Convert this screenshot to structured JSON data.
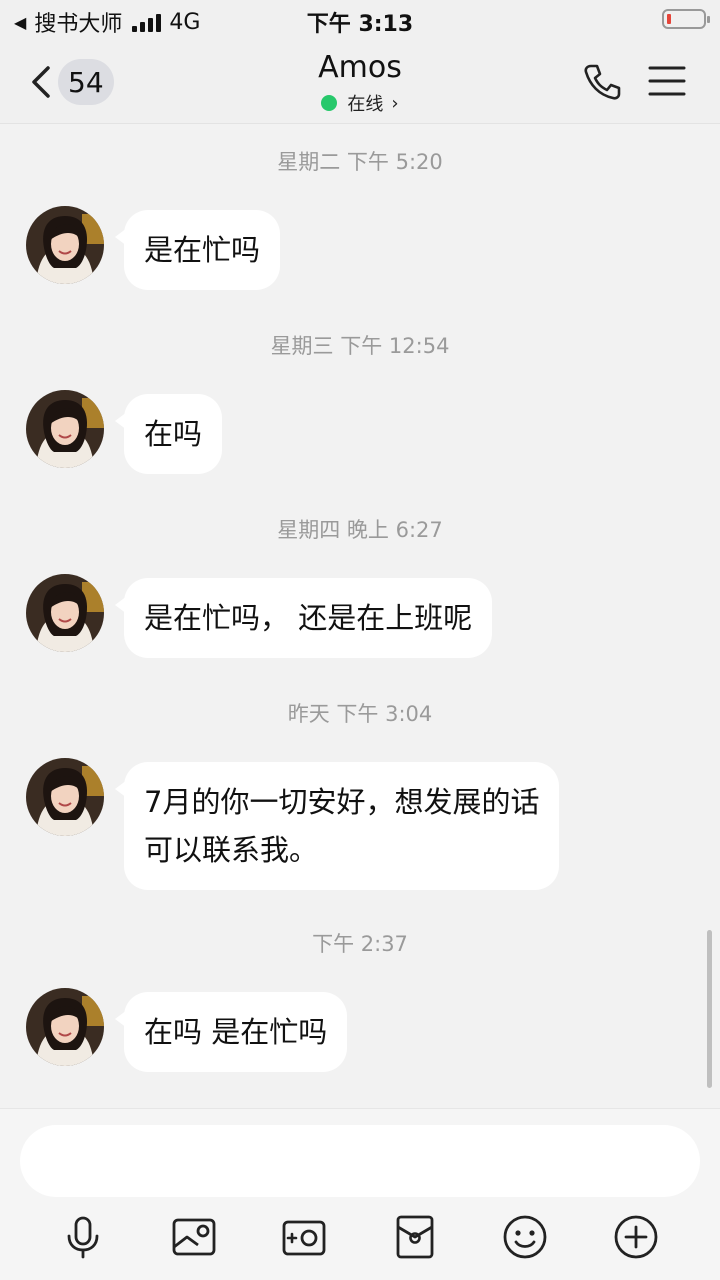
{
  "status_bar": {
    "carrier": "搜书大师",
    "network": "4G",
    "time": "下午 3:13"
  },
  "header": {
    "unread_count": "54",
    "contact_name": "Amos",
    "online_status": "在线",
    "online_color": "#27c86b"
  },
  "messages": [
    {
      "time": "星期二 下午 5:20",
      "text": "是在忙吗"
    },
    {
      "time": "星期三 下午 12:54",
      "text": "在吗"
    },
    {
      "time": "星期四 晚上 6:27",
      "text": "是在忙吗， 还是在上班呢"
    },
    {
      "time": "昨天 下午 3:04",
      "text": "7月的你一切安好，想发展的话\n可以联系我。"
    },
    {
      "time": "下午 2:37",
      "text": "在吗   是在忙吗"
    }
  ],
  "input": {
    "placeholder": ""
  },
  "toolbar": {
    "icons": [
      "microphone-icon",
      "photo-icon",
      "camera-icon",
      "red-packet-icon",
      "emoji-icon",
      "plus-icon"
    ]
  }
}
